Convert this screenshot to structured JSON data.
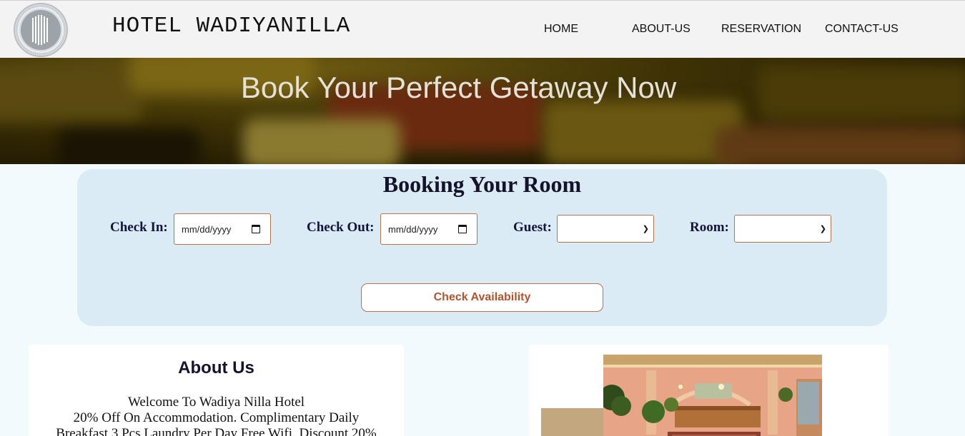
{
  "header": {
    "logo_name": "hotel-logo",
    "logo_text": "HOTEL WADIYANILLA",
    "brand": "HOTEL WADIYANILLA",
    "nav": [
      "HOME",
      "ABOUT-US",
      "RESERVATION",
      "CONTACT-US"
    ]
  },
  "hero": {
    "title": "Book Your Perfect Getaway Now"
  },
  "booking": {
    "title": "Booking Your Room",
    "check_in_label": "Check In:",
    "check_in_value": "mm/dd/yyyy",
    "check_out_label": "Check Out:",
    "check_out_value": "mm/dd/yyyy",
    "guest_label": "Guest:",
    "guest_value": "",
    "room_label": "Room:",
    "room_value": "",
    "button": "Check Availability"
  },
  "about": {
    "title": "About Us",
    "line1": "Welcome To Wadiya Nilla Hotel",
    "line2": "20% Off On Accommodation. Complimentary Daily",
    "line3": "Breakfast 3 Pcs Laundry Per Day Free Wifi. Discount 20%"
  },
  "colors": {
    "accent": "#b3542c",
    "booking_bg": "#dbebf5",
    "heading": "#14132b"
  },
  "icons": [
    "calendar-icon",
    "chevron-down-icon"
  ]
}
